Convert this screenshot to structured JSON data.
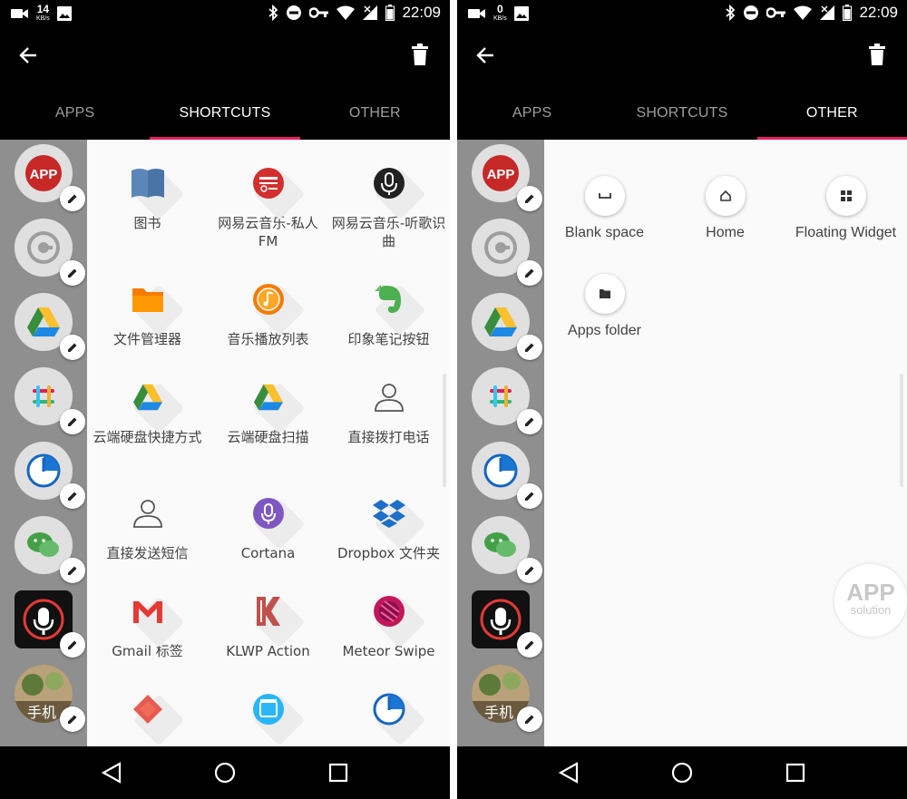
{
  "colors": {
    "accent": "#e91e63",
    "sidebar_bg": "#8f8f8f",
    "bar_bg": "#000000"
  },
  "left_phone": {
    "status": {
      "net_speed": "14",
      "net_unit": "KB/s",
      "time": "22:09"
    },
    "tabs": [
      {
        "label": "APPS",
        "active": false
      },
      {
        "label": "SHORTCUTS",
        "active": true
      },
      {
        "label": "OTHER",
        "active": false
      }
    ],
    "grid": [
      {
        "label": "图书",
        "icon": "book-icon"
      },
      {
        "label": "网易云音乐-私人FM",
        "icon": "netease-radio-icon"
      },
      {
        "label": "网易云音乐-听歌识曲",
        "icon": "netease-mic-icon"
      },
      {
        "label": "文件管理器",
        "icon": "folder-icon"
      },
      {
        "label": "音乐播放列表",
        "icon": "music-playlist-icon"
      },
      {
        "label": "印象笔记按钮",
        "icon": "evernote-icon"
      },
      {
        "label": "云端硬盘快捷方式",
        "icon": "drive-icon"
      },
      {
        "label": "云端硬盘扫描",
        "icon": "drive-scan-icon"
      },
      {
        "label": "直接拨打电话",
        "icon": "contact-call-icon"
      },
      {
        "label": "直接发送短信",
        "icon": "contact-sms-icon"
      },
      {
        "label": "Cortana",
        "icon": "cortana-mic-icon"
      },
      {
        "label": "Dropbox 文件夹",
        "icon": "dropbox-icon"
      },
      {
        "label": "Gmail 标签",
        "icon": "gmail-icon"
      },
      {
        "label": "KLWP Action",
        "icon": "klwp-icon"
      },
      {
        "label": "Meteor Swipe",
        "icon": "meteor-swipe-icon"
      },
      {
        "label": "",
        "icon": "diamond-app-icon"
      },
      {
        "label": "",
        "icon": "tv-app-icon"
      },
      {
        "label": "",
        "icon": "clock-app-icon"
      }
    ]
  },
  "right_phone": {
    "status": {
      "net_speed": "0",
      "net_unit": "KB/s",
      "time": "22:09"
    },
    "tabs": [
      {
        "label": "APPS",
        "active": false
      },
      {
        "label": "SHORTCUTS",
        "active": false
      },
      {
        "label": "OTHER",
        "active": true
      }
    ],
    "other_items": [
      {
        "label": "Blank space",
        "icon": "blank-space-icon"
      },
      {
        "label": "Home",
        "icon": "home-icon"
      },
      {
        "label": "Floating Widget",
        "icon": "widget-grid-icon"
      },
      {
        "label": "Apps folder",
        "icon": "apps-folder-icon"
      }
    ]
  },
  "sidebar_items": [
    {
      "icon": "app-logo-icon",
      "text": "APP"
    },
    {
      "icon": "gear-circle-icon",
      "text": ""
    },
    {
      "icon": "google-drive-icon",
      "text": ""
    },
    {
      "icon": "slack-icon",
      "text": ""
    },
    {
      "icon": "pie-clock-icon",
      "text": ""
    },
    {
      "icon": "wechat-icon",
      "text": ""
    },
    {
      "icon": "voice-mic-icon",
      "text": ""
    },
    {
      "icon": "photo-thumbnail-icon",
      "text": "手机"
    }
  ],
  "watermark": {
    "line1": "APP",
    "line2": "solution"
  }
}
